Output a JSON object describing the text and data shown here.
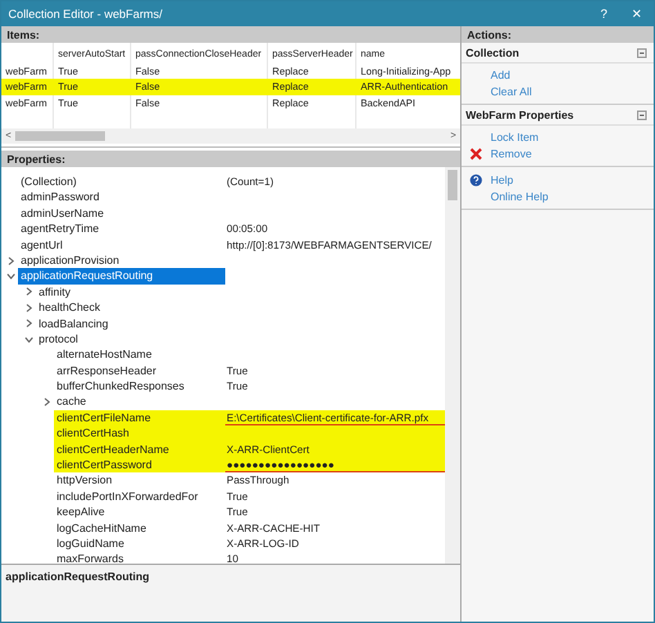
{
  "window": {
    "title": "Collection Editor - webFarms/",
    "help_button": "?",
    "close_button": "✕"
  },
  "items": {
    "header": "Items:",
    "columns": [
      "",
      "serverAutoStart",
      "passConnectionCloseHeader",
      "passServerHeader",
      "name"
    ],
    "rows": [
      {
        "cells": [
          "webFarm",
          "True",
          "False",
          "Replace",
          "Long-Initializing-App"
        ],
        "selected": false
      },
      {
        "cells": [
          "webFarm",
          "True",
          "False",
          "Replace",
          "ARR-Authentication"
        ],
        "selected": true
      },
      {
        "cells": [
          "webFarm",
          "True",
          "False",
          "Replace",
          "BackendAPI"
        ],
        "selected": false
      }
    ],
    "scroll_left": "<",
    "scroll_right": ">"
  },
  "properties": {
    "header": "Properties:",
    "rows": [
      {
        "name": "(Collection)",
        "value": "(Count=1)"
      },
      {
        "name": "adminPassword"
      },
      {
        "name": "adminUserName"
      },
      {
        "name": "agentRetryTime",
        "value": "00:05:00"
      },
      {
        "name": "agentUrl",
        "value": "http://[0]:8173/WEBFARMAGENTSERVICE/"
      },
      {
        "name": "applicationProvision",
        "expanded": false
      },
      {
        "name": "applicationRequestRouting",
        "expanded": true,
        "selected": true,
        "children": [
          {
            "name": "affinity",
            "expanded": false
          },
          {
            "name": "healthCheck",
            "expanded": false
          },
          {
            "name": "loadBalancing",
            "expanded": false
          },
          {
            "name": "protocol",
            "expanded": true,
            "children": [
              {
                "name": "alternateHostName"
              },
              {
                "name": "arrResponseHeader",
                "value": "True"
              },
              {
                "name": "bufferChunkedResponses",
                "value": "True"
              },
              {
                "name": "cache",
                "expanded": false
              },
              {
                "name": "clientCertFileName",
                "value": "E:\\Certificates\\Client-certificate-for-ARR.pfx",
                "highlighted": true,
                "underlined": true
              },
              {
                "name": "clientCertHash",
                "highlighted": true
              },
              {
                "name": "clientCertHeaderName",
                "value": "X-ARR-ClientCert",
                "highlighted": true
              },
              {
                "name": "clientCertPassword",
                "value": "●●●●●●●●●●●●●●●●●",
                "highlighted": true,
                "underlined": true
              },
              {
                "name": "httpVersion",
                "value": "PassThrough"
              },
              {
                "name": "includePortInXForwardedFor",
                "value": "True"
              },
              {
                "name": "keepAlive",
                "value": "True"
              },
              {
                "name": "logCacheHitName",
                "value": "X-ARR-CACHE-HIT"
              },
              {
                "name": "logGuidName",
                "value": "X-ARR-LOG-ID"
              },
              {
                "name": "maxForwards",
                "value": "10"
              }
            ]
          }
        ]
      }
    ]
  },
  "description": {
    "title": "applicationRequestRouting"
  },
  "actions": {
    "header": "Actions:",
    "sections": [
      {
        "title": "Collection",
        "items": [
          {
            "label": "Add",
            "kind": "plain"
          },
          {
            "label": "Clear All",
            "kind": "plain"
          }
        ]
      },
      {
        "title": "WebFarm Properties",
        "items": [
          {
            "label": "Lock Item",
            "kind": "plain"
          },
          {
            "label": "Remove",
            "kind": "remove"
          }
        ]
      },
      {
        "items": [
          {
            "label": "Help",
            "kind": "help"
          },
          {
            "label": "Online Help",
            "kind": "plain"
          }
        ]
      }
    ]
  }
}
